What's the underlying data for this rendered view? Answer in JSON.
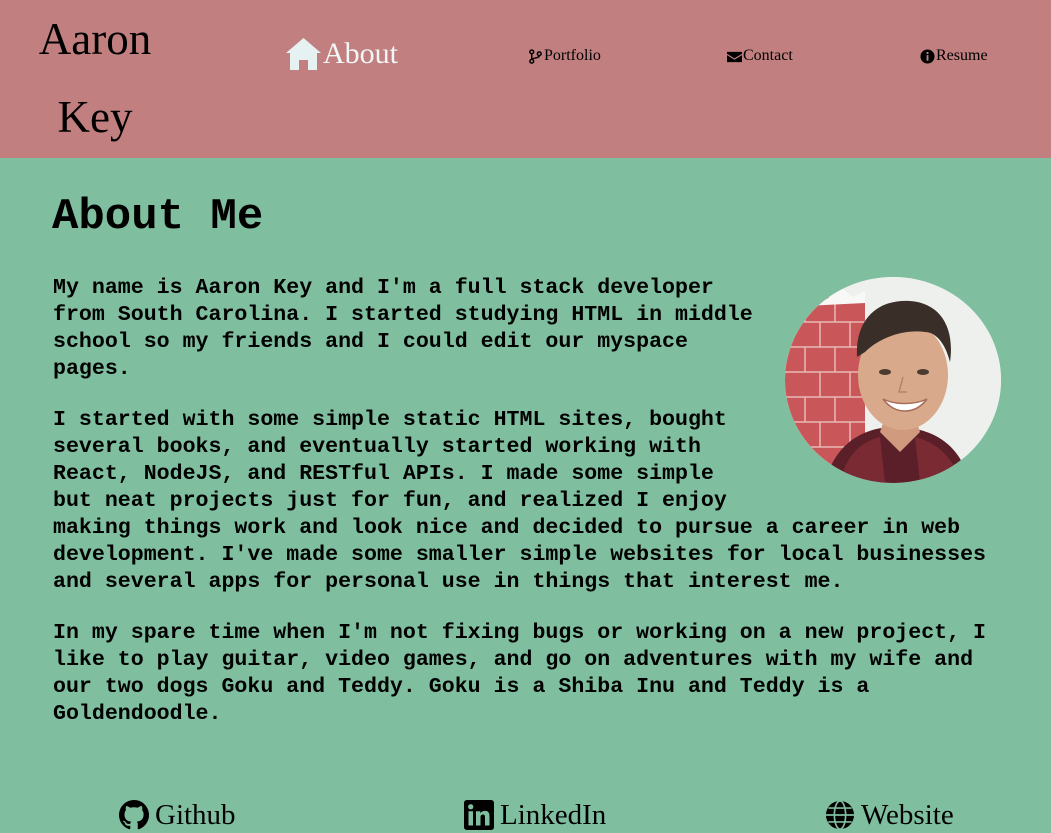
{
  "header": {
    "brand_line1": "Aaron",
    "brand_line2": "Key",
    "nav": {
      "about": "About",
      "portfolio": "Portfolio",
      "contact": "Contact",
      "resume": "Resume"
    }
  },
  "main": {
    "title": "About Me",
    "paragraphs": [
      "My name is Aaron Key and I'm a full stack developer from South Carolina. I started studying HTML in middle school so my friends and I could edit our myspace pages.",
      "I started with some simple static HTML sites, bought several books, and eventually started working with React, NodeJS, and RESTful APIs. I made some simple but neat projects just for fun, and realized I enjoy making things work and look nice and decided to pursue a career in web development. I've made some smaller simple websites for local businesses and several apps for personal use in things that interest me.",
      "In my spare time when I'm not fixing bugs or working on a new project, I like to play guitar, video games, and go on adventures with my wife and our two dogs Goku and Teddy. Goku is a Shiba Inu and Teddy is a Goldendoodle."
    ]
  },
  "footer": {
    "github": "Github",
    "linkedin": "LinkedIn",
    "website": "Website"
  },
  "icons": {
    "about": "home-icon",
    "portfolio": "code-branch-icon",
    "contact": "envelope-icon",
    "resume": "info-circle-icon",
    "github": "github-icon",
    "linkedin": "linkedin-icon",
    "website": "globe-icon"
  },
  "colors": {
    "header_bg": "#c17f7f",
    "page_bg": "#7fbfa0",
    "active_nav": "#f1f6f6"
  }
}
